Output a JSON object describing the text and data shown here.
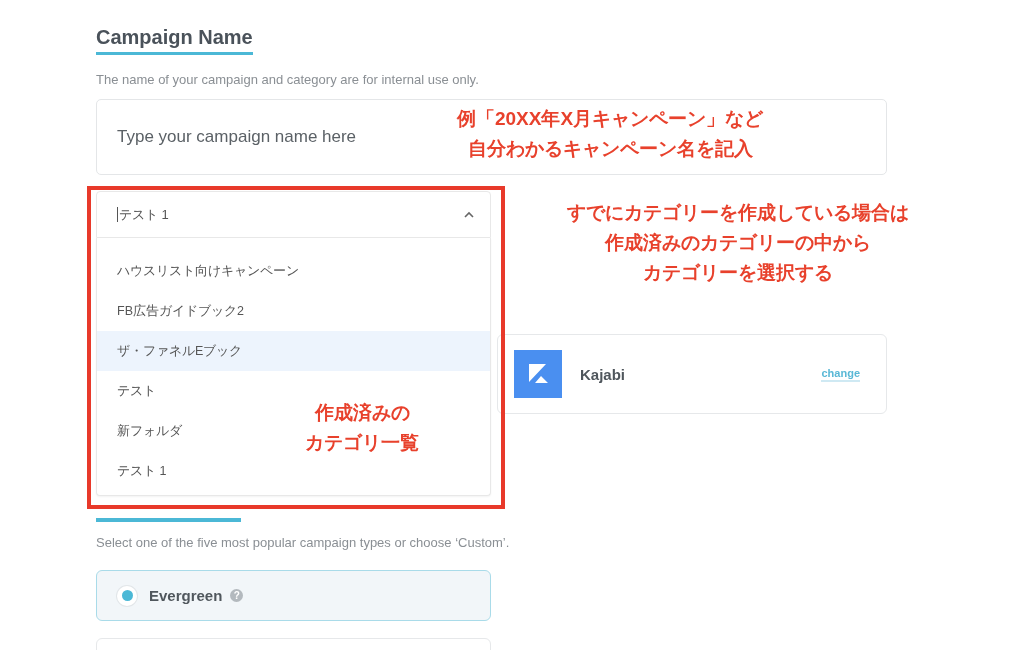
{
  "campaign_name": {
    "heading": "Campaign Name",
    "description": "The name of your campaign and category are for internal use only.",
    "name_field": {
      "placeholder": "Type your campaign name here"
    },
    "category_select": {
      "value": "テスト 1",
      "expanded": true,
      "options": [
        {
          "label": "ハウスリスト向けキャンペーン",
          "highlighted": false
        },
        {
          "label": "FB広告ガイドブック2",
          "highlighted": false
        },
        {
          "label": "ザ・ファネルEブック",
          "highlighted": true
        },
        {
          "label": "テスト",
          "highlighted": false
        },
        {
          "label": "新フォルダ",
          "highlighted": false
        },
        {
          "label": "テスト 1",
          "highlighted": false
        }
      ]
    },
    "integration": {
      "name": "Kajabi",
      "action": "change"
    }
  },
  "campaign_type": {
    "description": "Select one of the five most popular campaign types or choose ‘Custom’.",
    "options": [
      {
        "label": "Evergreen",
        "help": "?",
        "selected": true
      },
      {
        "selected": false
      }
    ]
  },
  "annotations": [
    {
      "kind": "callout",
      "lines": [
        "例「20XX年X月キャンペーン」など",
        "自分わかるキャンペーン名を記入"
      ]
    },
    {
      "kind": "callout",
      "lines": [
        "すでにカテゴリーを作成している場合は",
        "作成済みのカテゴリーの中から",
        "カテゴリーを選択する"
      ]
    },
    {
      "kind": "callout",
      "lines": [
        "作成済みの",
        "カテゴリ一覧"
      ]
    },
    {
      "kind": "frame"
    }
  ]
}
